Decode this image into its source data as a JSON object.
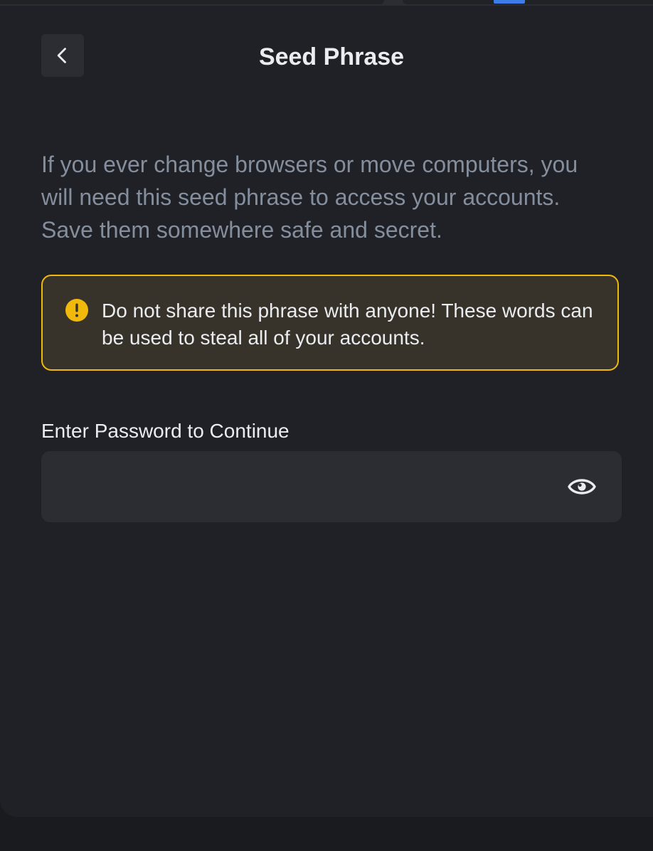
{
  "header": {
    "title": "Seed Phrase",
    "back_icon": "chevron-left-icon"
  },
  "description": "If you ever change browsers or move computers, you will need this seed phrase to access your accounts. Save them somewhere safe and secret.",
  "warning": {
    "icon": "exclamation-circle-icon",
    "text": "Do not share this phrase with anyone! These words can be used to steal all of your accounts."
  },
  "password": {
    "label": "Enter Password to Continue",
    "value": "",
    "placeholder": "",
    "toggle_icon": "eye-icon"
  },
  "colors": {
    "background": "#202126",
    "accent": "#f0b90b",
    "warning_bg": "#37332a",
    "text_primary": "#eaecef",
    "text_secondary": "#848e9c",
    "field_bg": "#2b2d33"
  }
}
